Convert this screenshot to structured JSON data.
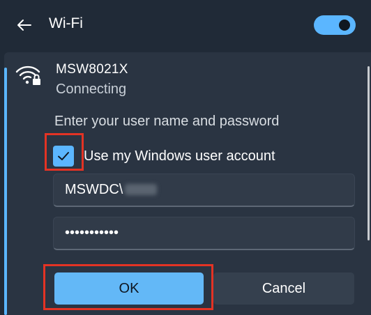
{
  "header": {
    "title": "Wi-Fi",
    "toggle_on": true
  },
  "network": {
    "name": "MSW8021X",
    "status": "Connecting",
    "prompt": "Enter your user name and password"
  },
  "credentials": {
    "use_windows_account_label": "Use my Windows user account",
    "use_windows_account_checked": true,
    "username_value": "MSWDC\\",
    "password_value": "•••••••••••"
  },
  "buttons": {
    "ok": "OK",
    "cancel": "Cancel"
  },
  "colors": {
    "accent": "#5bb6ff",
    "highlight": "#e33324",
    "background": "#202a37"
  }
}
